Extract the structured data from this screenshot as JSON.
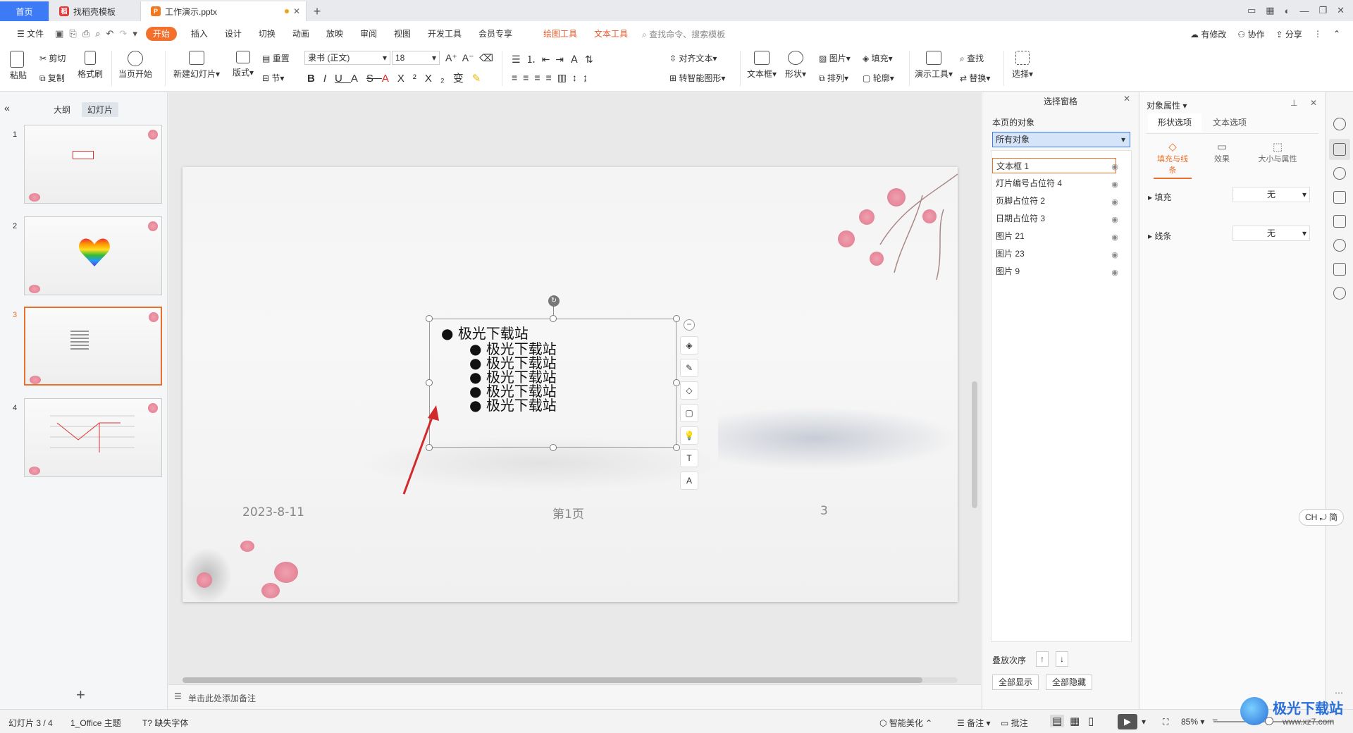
{
  "tabs": {
    "home": "首页",
    "template_tab": "找稻壳模板",
    "doc_tab": "工作演示.pptx",
    "new_tab": "+"
  },
  "menu": {
    "file": "文件",
    "items": [
      "开始",
      "插入",
      "设计",
      "切换",
      "动画",
      "放映",
      "审阅",
      "视图",
      "开发工具",
      "会员专享"
    ],
    "context_tools": [
      "绘图工具",
      "文本工具"
    ],
    "search_placeholder": "查找命令、搜索模板",
    "right": {
      "modified": "有修改",
      "collab": "协作",
      "share": "分享"
    }
  },
  "ribbon": {
    "paste": "粘贴",
    "cut": "剪切",
    "copy": "复制",
    "format_painter": "格式刷",
    "from_current": "当页开始",
    "new_slide": "新建幻灯片",
    "layout": "版式",
    "reset": "重置",
    "section": "节",
    "font_name": "隶书 (正文)",
    "font_size": "18",
    "align_text": "对齐文本",
    "smart_shape": "转智能图形",
    "textbox": "文本框",
    "shape": "形状",
    "picture": "图片",
    "fill": "填充",
    "arrange": "排列",
    "outline": "轮廓",
    "presenter_tools": "演示工具",
    "find": "查找",
    "replace": "替换",
    "select": "选择"
  },
  "left_panel": {
    "outline_tab": "大纲",
    "slides_tab": "幻灯片",
    "slide_numbers": [
      "1",
      "2",
      "3",
      "4"
    ],
    "add": "+"
  },
  "slide": {
    "bullets": [
      "极光下载站",
      "极光下载站",
      "极光下载站",
      "极光下载站",
      "极光下载站",
      "极光下载站"
    ],
    "footer_date": "2023-8-11",
    "footer_center": "第1页",
    "footer_number": "3"
  },
  "notes_placeholder": "单击此处添加备注",
  "selection_pane": {
    "title": "选择窗格",
    "section_label": "本页的对象",
    "filter": "所有对象",
    "objects": [
      "文本框 1",
      "灯片编号占位符 4",
      "页脚占位符 2",
      "日期占位符 3",
      "图片 21",
      "图片 23",
      "图片 9"
    ],
    "stack_order": "叠放次序",
    "show_all": "全部显示",
    "hide_all": "全部隐藏"
  },
  "object_props": {
    "title": "对象属性",
    "tab_shape": "形状选项",
    "tab_text": "文本选项",
    "sub_fill_line": "填充与线条",
    "sub_effect": "效果",
    "sub_size": "大小与属性",
    "fill_label": "填充",
    "fill_value": "无",
    "line_label": "线条",
    "line_value": "无"
  },
  "status": {
    "slide_pos": "幻灯片 3 / 4",
    "theme": "1_Office 主题",
    "missing_font": "缺失字体",
    "smart_beautify": "智能美化",
    "notes": "备注",
    "comments": "批注",
    "zoom": "85%"
  },
  "ime": "CH ⤾ 简",
  "watermark": {
    "text": "极光下载站",
    "url": "www.xz7.com"
  },
  "colors": {
    "accent": "#e8702a",
    "home_tab": "#3d7af5",
    "context": "#e85a2a",
    "arrow": "#d22a2a"
  }
}
